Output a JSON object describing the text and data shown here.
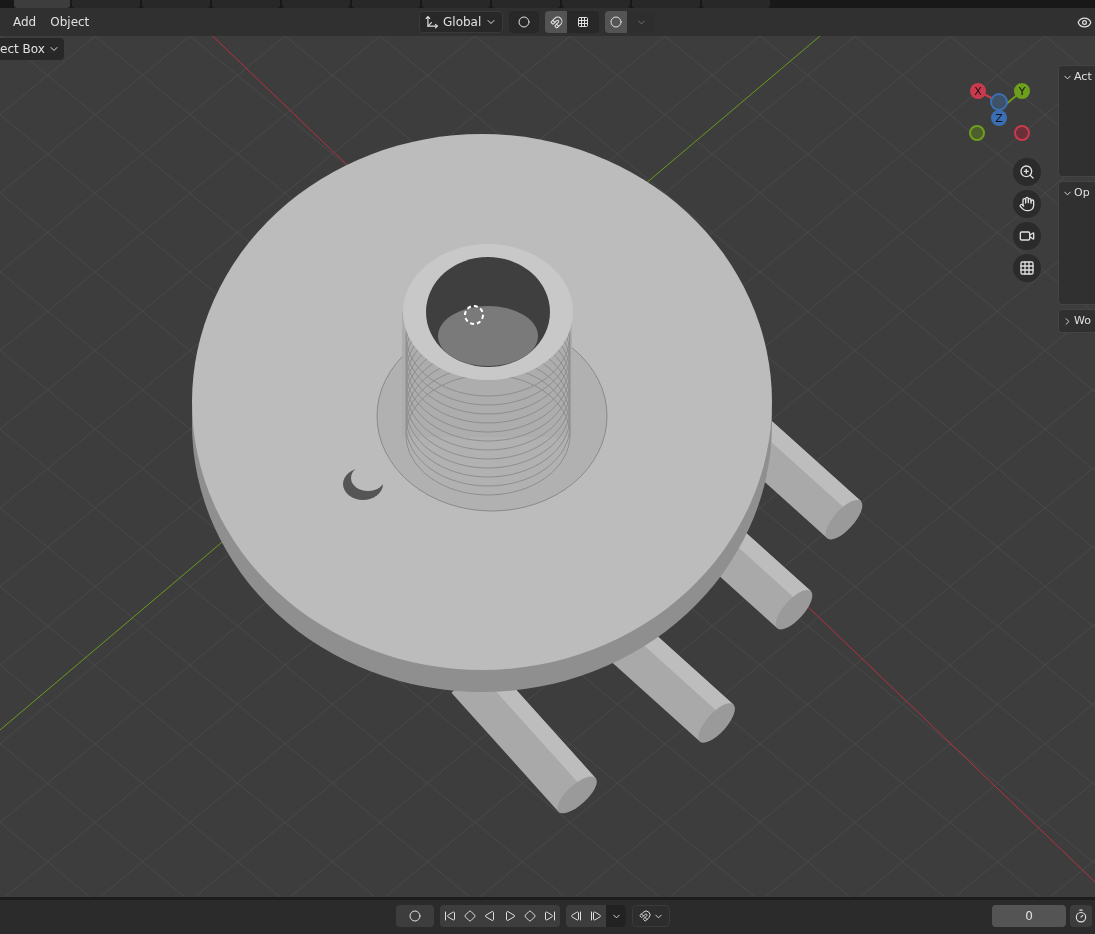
{
  "workspace_tabs": [
    {
      "selected": true
    },
    {
      "selected": false
    },
    {
      "selected": false
    },
    {
      "selected": false
    },
    {
      "selected": false
    },
    {
      "selected": false
    },
    {
      "selected": false
    },
    {
      "selected": false
    },
    {
      "selected": false
    },
    {
      "selected": false
    },
    {
      "selected": false
    }
  ],
  "header": {
    "menus": [
      "Add",
      "Object"
    ],
    "transform_orientation": "Global",
    "snap": {
      "on": true
    },
    "proportional_editing": {
      "on": true
    }
  },
  "select_mode": "ect Box",
  "gizmo": {
    "axes": [
      {
        "label": "X",
        "color": "#c93a4f"
      },
      {
        "label": "Y",
        "color": "#6d9e1c"
      },
      {
        "label": "Z",
        "color": "#3a6fb5"
      }
    ]
  },
  "side_panels": [
    {
      "title": "Act",
      "expanded": true
    },
    {
      "title": "Op",
      "expanded": true
    },
    {
      "title": "Wo",
      "expanded": false
    }
  ],
  "timeline": {
    "auto_keying": {
      "on": false
    },
    "current_frame": "0"
  }
}
